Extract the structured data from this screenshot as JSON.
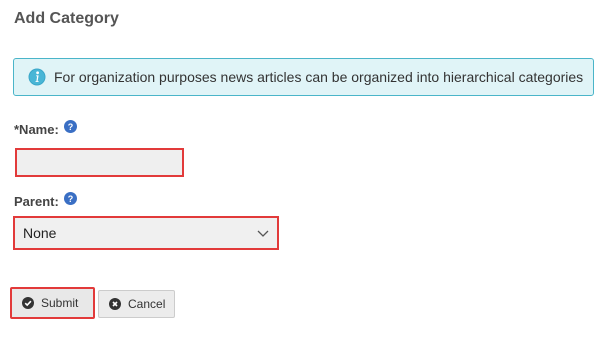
{
  "page": {
    "title": "Add Category"
  },
  "info": {
    "text": "For organization purposes news articles can be organized into hierarchical categories",
    "icon": "info-icon",
    "accent_color": "#4ab5c9",
    "background_color": "#e0f4f7"
  },
  "form": {
    "name": {
      "label": "*Name:",
      "value": "",
      "placeholder": "",
      "help_icon": "help-icon"
    },
    "parent": {
      "label": "Parent:",
      "selected": "None",
      "help_icon": "help-icon"
    }
  },
  "buttons": {
    "submit_label": "Submit",
    "cancel_label": "Cancel"
  },
  "colors": {
    "highlight": "#e23a3a",
    "help_icon": "#3a6fc4"
  }
}
